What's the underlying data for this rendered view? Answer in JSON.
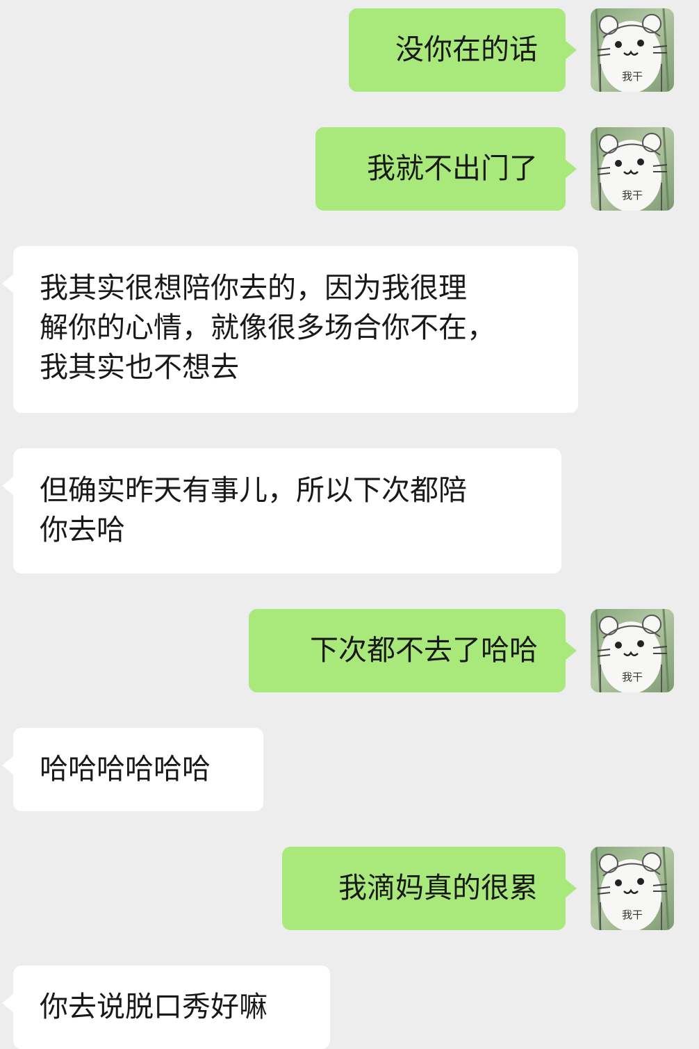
{
  "colors": {
    "background": "#ededed",
    "sent_bubble": "#a9e97b",
    "received_bubble": "#ffffff",
    "text": "#191919"
  },
  "avatar": {
    "icon": "white-cat-sticker-icon",
    "caption": "我干"
  },
  "messages": [
    {
      "side": "sent",
      "lines": [
        "没你在的话"
      ]
    },
    {
      "side": "sent",
      "lines": [
        "我就不出门了"
      ]
    },
    {
      "side": "received",
      "lines": [
        "我其实很想陪你去的，因为我很理",
        "解你的心情，就像很多场合你不在，",
        "我其实也不想去"
      ]
    },
    {
      "side": "received",
      "lines": [
        "但确实昨天有事儿，所以下次都陪",
        "你去哈"
      ]
    },
    {
      "side": "sent",
      "lines": [
        "下次都不去了哈哈"
      ]
    },
    {
      "side": "received",
      "lines": [
        "哈哈哈哈哈哈"
      ]
    },
    {
      "side": "sent",
      "lines": [
        "我滴妈真的很累"
      ]
    },
    {
      "side": "received",
      "lines": [
        "你去说脱口秀好嘛"
      ]
    }
  ]
}
